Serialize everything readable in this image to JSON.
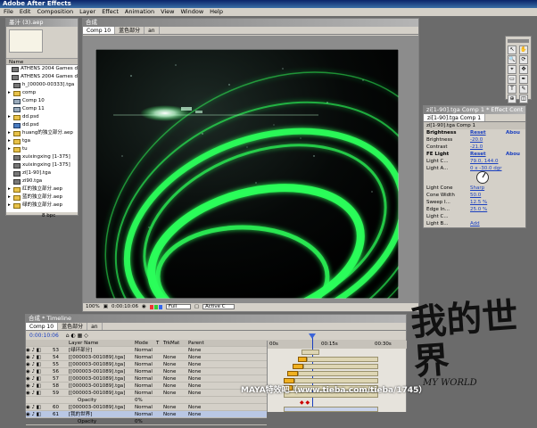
{
  "app": {
    "title": "Adobe After Effects",
    "menu": [
      "File",
      "Edit",
      "Composition",
      "Layer",
      "Effect",
      "Animation",
      "View",
      "Window",
      "Help"
    ]
  },
  "project": {
    "title": "墨汁 (3).aep",
    "column_header": "Name",
    "items": [
      {
        "icon": "footage",
        "name": "ATHENS 2004 Games d"
      },
      {
        "icon": "footage",
        "name": "ATHENS 2004 Games d"
      },
      {
        "icon": "footage",
        "name": "h_[00000-00333].tga"
      },
      {
        "icon": "folder",
        "name": "comp"
      },
      {
        "icon": "comp",
        "name": "Comp 10"
      },
      {
        "icon": "comp",
        "name": "Comp 11"
      },
      {
        "icon": "folder",
        "name": "dd.psd"
      },
      {
        "icon": "psd",
        "name": "dd.psd"
      },
      {
        "icon": "folder",
        "name": "huang的独立部分.aep"
      },
      {
        "icon": "folder",
        "name": "tga"
      },
      {
        "icon": "folder",
        "name": "tu"
      },
      {
        "icon": "footage",
        "name": "xuixingxing [1-375]"
      },
      {
        "icon": "footage",
        "name": "xuixingxing [1-375]"
      },
      {
        "icon": "footage",
        "name": "zi[1-90].tga"
      },
      {
        "icon": "footage",
        "name": "zi90.tga"
      },
      {
        "icon": "folder",
        "name": "红的独立部分.aep"
      },
      {
        "icon": "folder",
        "name": "蓝的独立部分.aep"
      },
      {
        "icon": "folder",
        "name": "绿的独立部分.aep"
      }
    ],
    "footer": "8 bpc"
  },
  "composition": {
    "title": "合成",
    "tabs": [
      "Comp 10",
      "蓝色部分",
      "an"
    ],
    "zoom": "100%",
    "timecode": "0:00:10:06",
    "resolution": "Full",
    "camera": "Active C"
  },
  "tools": [
    "select-tool",
    "hand-tool",
    "zoom-tool",
    "rotate-tool",
    "camera-tool",
    "pan-tool",
    "mask-tool",
    "pen-tool",
    "text-tool",
    "brush-tool",
    "stamp-tool",
    "eraser-tool"
  ],
  "effects": {
    "title": "zi[1-90].tga Comp 1 * Effect Cont",
    "tab": "zi[1-90].tga Comp 1",
    "layer": "zi[1-90].tga Comp 1",
    "rows": [
      {
        "name": "Brightness",
        "value": "Reset",
        "extra": "Abou"
      },
      {
        "name": "Brightness",
        "value": "-20.0",
        "extra": ""
      },
      {
        "name": "Contrast",
        "value": "-21.0",
        "extra": ""
      },
      {
        "name": "FE Light",
        "value": "Reset",
        "extra": "Abou"
      },
      {
        "name": "Light C...",
        "value": "79.0, 144.0",
        "extra": ""
      },
      {
        "name": "Light A...",
        "value": "0 x -30.0 dgr",
        "extra": ""
      },
      {
        "name": "",
        "value": "",
        "extra": ""
      },
      {
        "name": "Light Cone",
        "value": "Sharp",
        "extra": ""
      },
      {
        "name": "Cone Width",
        "value": "50.0",
        "extra": ""
      },
      {
        "name": "Sweep I...",
        "value": "12.5 %",
        "extra": ""
      },
      {
        "name": "Edge In...",
        "value": "25.0 %",
        "extra": ""
      },
      {
        "name": "Light C...",
        "value": "",
        "extra": ""
      },
      {
        "name": "Light B...",
        "value": "Add",
        "extra": ""
      }
    ]
  },
  "timeline": {
    "title": "合成 * Timeline",
    "tabs": [
      "Comp 10",
      "蓝色部分",
      "an"
    ],
    "timecode": "0:00:10:06",
    "columns": [
      "Layer Name",
      "Mode",
      "T",
      "TrkMat",
      "Parent"
    ],
    "ruler": [
      "00s",
      "00:15s",
      "00:30s"
    ],
    "layers": [
      {
        "num": "53",
        "name": "[绿环部分]",
        "mode": "Normal",
        "trk": "",
        "parent": "None",
        "selected": false
      },
      {
        "num": "54",
        "name": "[[000003-001089].tga]",
        "mode": "Normal",
        "trk": "None",
        "parent": "None",
        "selected": false
      },
      {
        "num": "55",
        "name": "[[000003-001089].tga]",
        "mode": "Normal",
        "trk": "None",
        "parent": "None",
        "selected": false
      },
      {
        "num": "56",
        "name": "[[000003-001089].tga]",
        "mode": "Normal",
        "trk": "None",
        "parent": "None",
        "selected": false
      },
      {
        "num": "57",
        "name": "[[000003-001089].tga]",
        "mode": "Normal",
        "trk": "None",
        "parent": "None",
        "selected": false
      },
      {
        "num": "58",
        "name": "[[000003-001089].tga]",
        "mode": "Normal",
        "trk": "None",
        "parent": "None",
        "selected": false
      },
      {
        "num": "59",
        "name": "[[000003-001089].tga]",
        "mode": "Normal",
        "trk": "None",
        "parent": "None",
        "selected": false
      },
      {
        "num": "",
        "name": "Opacity",
        "mode": "0%",
        "trk": "",
        "parent": "",
        "selected": false
      },
      {
        "num": "60",
        "name": "[[000003-001089].tga]",
        "mode": "Normal",
        "trk": "None",
        "parent": "None",
        "selected": false
      },
      {
        "num": "61",
        "name": "[我的世界]",
        "mode": "Normal",
        "trk": "None",
        "parent": "None",
        "selected": true
      },
      {
        "num": "",
        "name": "Opacity",
        "mode": "0%",
        "trk": "",
        "parent": "",
        "selected": false
      }
    ]
  },
  "watermark": {
    "big": "我的世界",
    "sub": "MY WORLD",
    "site": "MAYA特效吧（www.tieba.com/tieba/1745）"
  },
  "colors": {
    "accent": "#0a246a",
    "glow": "#2cff5a",
    "panel": "#d4d0c8"
  }
}
